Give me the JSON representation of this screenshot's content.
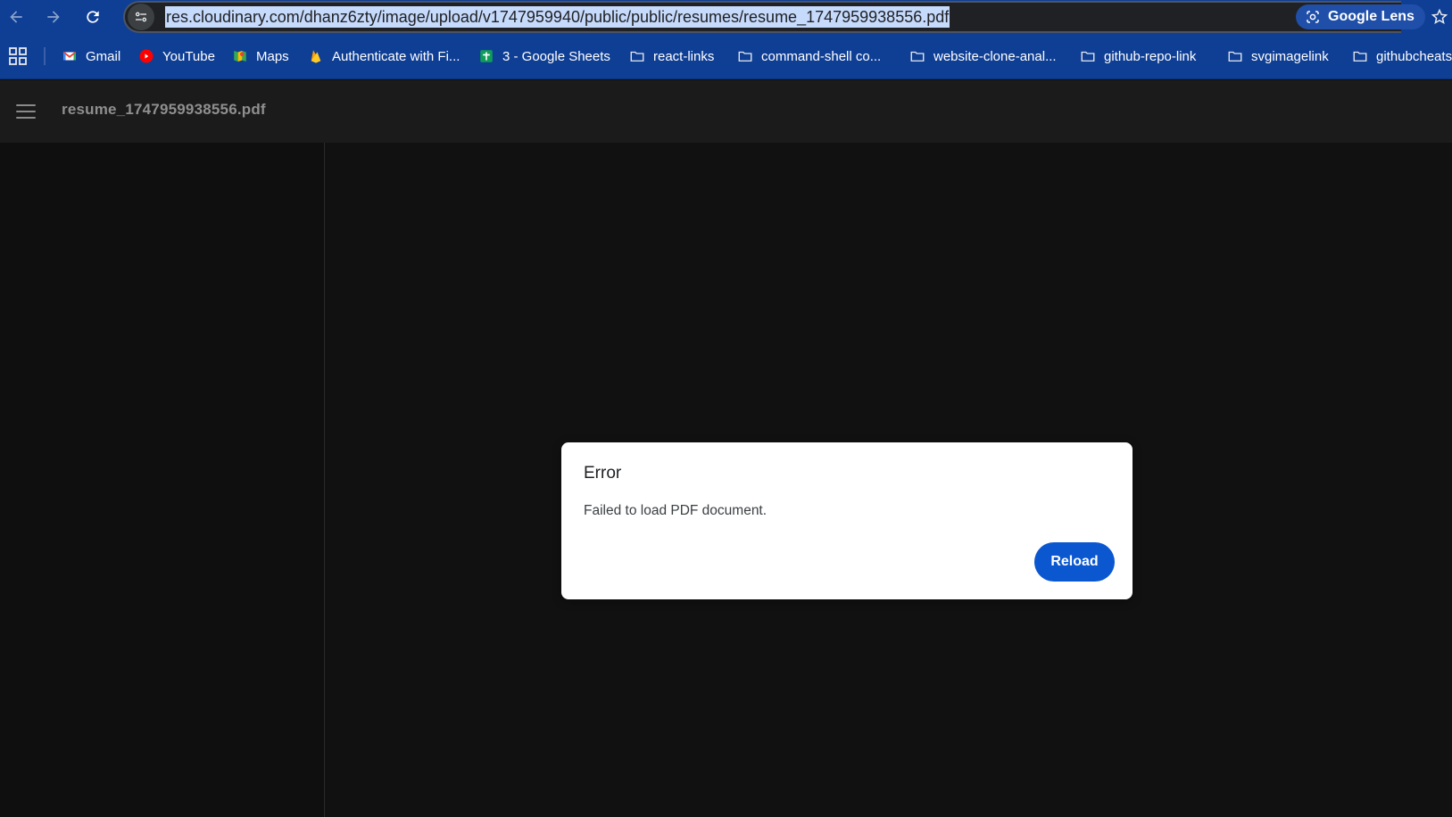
{
  "browser": {
    "url": "res.cloudinary.com/dhanz6zty/image/upload/v1747959940/public/public/resumes/resume_1747959938556.pdf",
    "lens_label": "Google Lens",
    "bookmarks": [
      {
        "label": "Gmail",
        "icon": "gmail-icon"
      },
      {
        "label": "YouTube",
        "icon": "youtube-icon"
      },
      {
        "label": "Maps",
        "icon": "maps-icon"
      },
      {
        "label": "Authenticate with Fi...",
        "icon": "firebase-icon"
      },
      {
        "label": "3 - Google Sheets",
        "icon": "sheets-icon"
      },
      {
        "label": "react-links",
        "icon": "folder-icon"
      },
      {
        "label": "command-shell co...",
        "icon": "folder-icon"
      },
      {
        "label": "website-clone-anal...",
        "icon": "folder-icon"
      },
      {
        "label": "github-repo-link",
        "icon": "folder-icon"
      },
      {
        "label": "svgimagelink",
        "icon": "folder-icon"
      },
      {
        "label": "githubcheats",
        "icon": "folder-icon"
      }
    ]
  },
  "viewer": {
    "doc_title": "resume_1747959938556.pdf"
  },
  "dialog": {
    "title": "Error",
    "message": "Failed to load PDF document.",
    "reload_label": "Reload"
  },
  "colors": {
    "chrome_blue": "#0f3f95",
    "button_blue": "#0b57d0",
    "viewer_bg": "#111111"
  }
}
